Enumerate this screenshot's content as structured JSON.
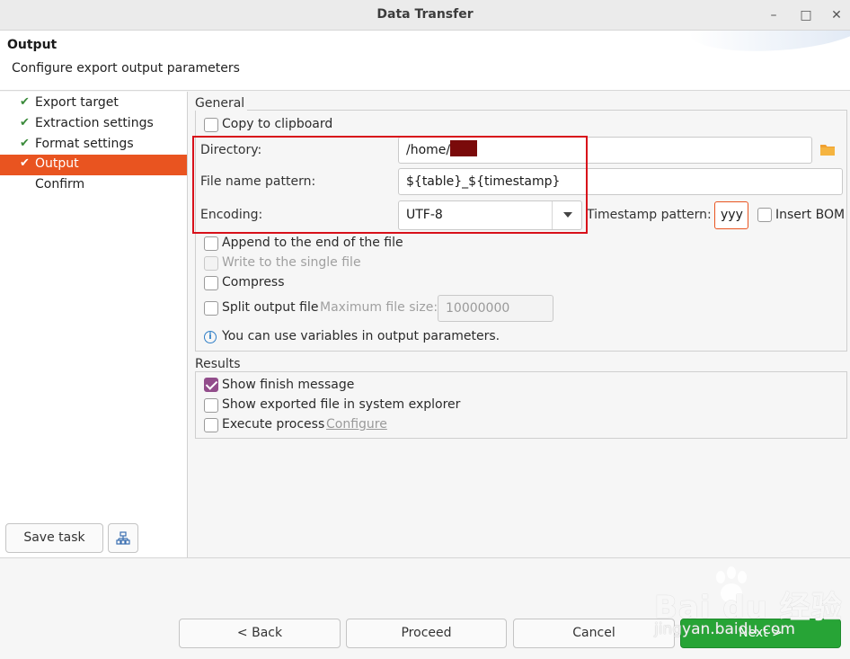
{
  "window": {
    "title": "Data Transfer",
    "min_glyph": "–",
    "max_glyph": "□",
    "close_glyph": "✕"
  },
  "header": {
    "title": "Output",
    "description": "Configure export output parameters"
  },
  "nav": {
    "items": [
      {
        "label": "Export target",
        "done": true
      },
      {
        "label": "Extraction settings",
        "done": true
      },
      {
        "label": "Format settings",
        "done": true
      },
      {
        "label": "Output",
        "done": true,
        "active": true
      },
      {
        "label": "Confirm",
        "done": false
      }
    ],
    "check_glyph": "✔"
  },
  "sidebar_buttons": {
    "save_task": "Save task",
    "network_icon": "network-icon"
  },
  "general": {
    "label": "General",
    "copy_to_clipboard": {
      "label": "Copy to clipboard",
      "checked": false
    },
    "directory": {
      "label": "Directory:",
      "value": "/home/"
    },
    "file_name_pattern": {
      "label": "File name pattern:",
      "value": "${table}_${timestamp}"
    },
    "encoding": {
      "label": "Encoding:",
      "value": "UTF-8"
    },
    "timestamp_pattern": {
      "label": "Timestamp pattern:",
      "value": "yyy"
    },
    "insert_bom": {
      "label": "Insert BOM",
      "checked": false
    },
    "append": {
      "label": "Append to the end of the file",
      "checked": false
    },
    "single_file": {
      "label": "Write to the single file",
      "checked": false,
      "disabled": true
    },
    "compress": {
      "label": "Compress",
      "checked": false
    },
    "split": {
      "label": "Split output file",
      "checked": false
    },
    "max_file_size": {
      "label": "Maximum file size:",
      "value": "10000000"
    },
    "info": "You can use variables in output parameters.",
    "info_glyph": "i"
  },
  "results": {
    "label": "Results",
    "show_finish_message": {
      "label": "Show finish message",
      "checked": true
    },
    "show_exported_file": {
      "label": "Show exported file in system explorer",
      "checked": false
    },
    "execute_process": {
      "label": "Execute process",
      "checked": false
    },
    "configure_link": "Configure"
  },
  "footer": {
    "back": "< Back",
    "proceed": "Proceed",
    "cancel": "Cancel",
    "next": "Next >"
  },
  "watermark": {
    "logo": "Bai du 经验",
    "url": "jingyan.baidu.com"
  },
  "colors": {
    "accent": "#e95420",
    "next_green": "#27a436",
    "checkbox_checked": "#924d8b",
    "highlight_red": "#d8101a",
    "check_green": "#3a8a3a"
  }
}
